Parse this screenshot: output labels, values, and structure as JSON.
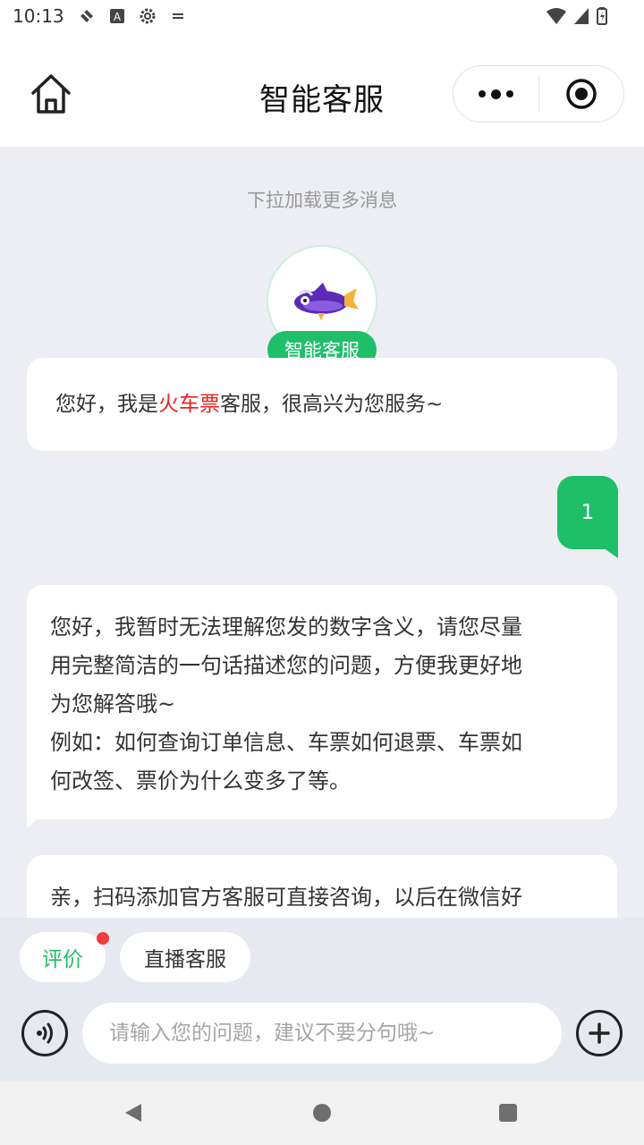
{
  "status_bar": {
    "time": "10:13"
  },
  "nav": {
    "title": "智能客服"
  },
  "chat": {
    "load_more": "下拉加载更多消息",
    "agent_tag": "智能客服",
    "msg1": {
      "prefix": "您好，我是",
      "highlight": "火车票",
      "suffix": "客服，很高兴为您服务~"
    },
    "user_msg": "1",
    "msg2": {
      "line1": "您好，我暂时无法理解您发的数字含义，请您尽量",
      "line2": "用完整简洁的一句话描述您的问题，方便我更好地",
      "line3": "为您解答哦~",
      "line4": "例如：如何查询订单信息、车票如何退票、车票如",
      "line5": "何改签、票价为什么变多了等。"
    },
    "msg3": "亲，扫码添加官方客服可直接咨询，以后在微信好"
  },
  "quick_actions": {
    "rate": "评价",
    "live_service": "直播客服"
  },
  "input": {
    "placeholder": "请输入您的问题，建议不要分句哦~"
  },
  "colors": {
    "accent": "#1fbf6a",
    "highlight": "#f02020",
    "badge": "#f23c3c",
    "background": "#eceef3"
  }
}
